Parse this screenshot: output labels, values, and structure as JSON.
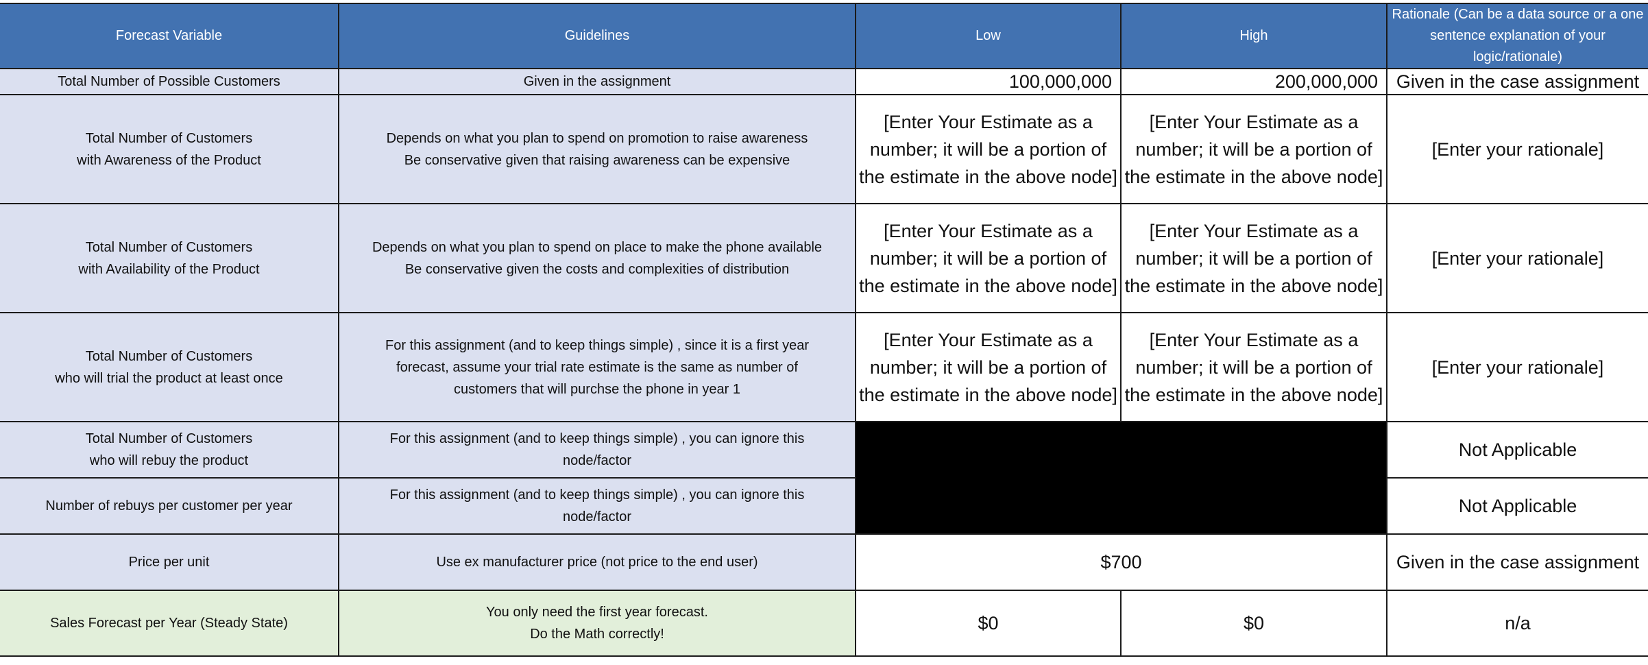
{
  "header": {
    "forecast_variable": "Forecast Variable",
    "guidelines": "Guidelines",
    "low": "Low",
    "high": "High",
    "rationale": "Rationale (Can be a data source or a one sentence explanation of your logic/rationale)"
  },
  "rows": [
    {
      "variable": "Total Number of Possible Customers",
      "guidelines": "Given in the assignment",
      "low": "100,000,000",
      "high": "200,000,000",
      "rationale": "Given in the case assignment"
    },
    {
      "variable_line1": "Total Number of Customers",
      "variable_line2": "with Awareness of the Product",
      "guidelines_line1": "Depends on what you plan to spend on promotion to raise awareness",
      "guidelines_line2": "Be conservative given that raising awareness can be expensive",
      "low": "[Enter Your Estimate as a number; it will be a portion of the estimate in the above node]",
      "high": "[Enter Your Estimate as a number; it will be a portion of the estimate in the above node]",
      "rationale": "[Enter your rationale]"
    },
    {
      "variable_line1": "Total Number of Customers",
      "variable_line2": "with Availability of the Product",
      "guidelines_line1": "Depends on what you plan to spend on place to make the phone available",
      "guidelines_line2": "Be conservative given the costs and complexities of distribution",
      "low": "[Enter Your Estimate as a number; it will be a portion of the estimate in the above node]",
      "high": "[Enter Your Estimate as a number; it will be a portion of the estimate in the above node]",
      "rationale": "[Enter your rationale]"
    },
    {
      "variable_line1": "Total Number of Customers",
      "variable_line2": "who will trial the product at least once",
      "guidelines": "For this assignment (and to keep things simple) , since it is a first year forecast, assume your trial rate estimate is the same as number of customers that will purchse the phone in year 1",
      "low": "[Enter Your Estimate as a number; it will be a portion of the estimate in the above node]",
      "high": "[Enter Your Estimate as a number; it will be a portion of the estimate in the above node]",
      "rationale": "[Enter your rationale]"
    },
    {
      "variable_line1": "Total Number of Customers",
      "variable_line2": "who will rebuy the product",
      "guidelines": "For this assignment (and to keep things simple) , you can ignore this node/factor",
      "rationale": "Not Applicable"
    },
    {
      "variable": "Number of rebuys per customer per year",
      "guidelines": "For this assignment (and to keep things simple) , you can ignore this node/factor",
      "rationale": "Not Applicable"
    },
    {
      "variable": "Price per unit",
      "guidelines": "Use ex manufacturer price (not price to the end user)",
      "value": "$700",
      "rationale": "Given in the case assignment"
    },
    {
      "variable": "Sales Forecast per Year (Steady State)",
      "guidelines_line1": "You only need the first year forecast.",
      "guidelines_line2": "Do the Math correctly!",
      "low": "$0",
      "high": "$0",
      "rationale": "n/a"
    }
  ],
  "colors": {
    "header_fill": "#4272b1",
    "input_row_fill": "#dbe0f0",
    "output_row_fill": "#e2efda",
    "blocked_fill": "#000000"
  }
}
